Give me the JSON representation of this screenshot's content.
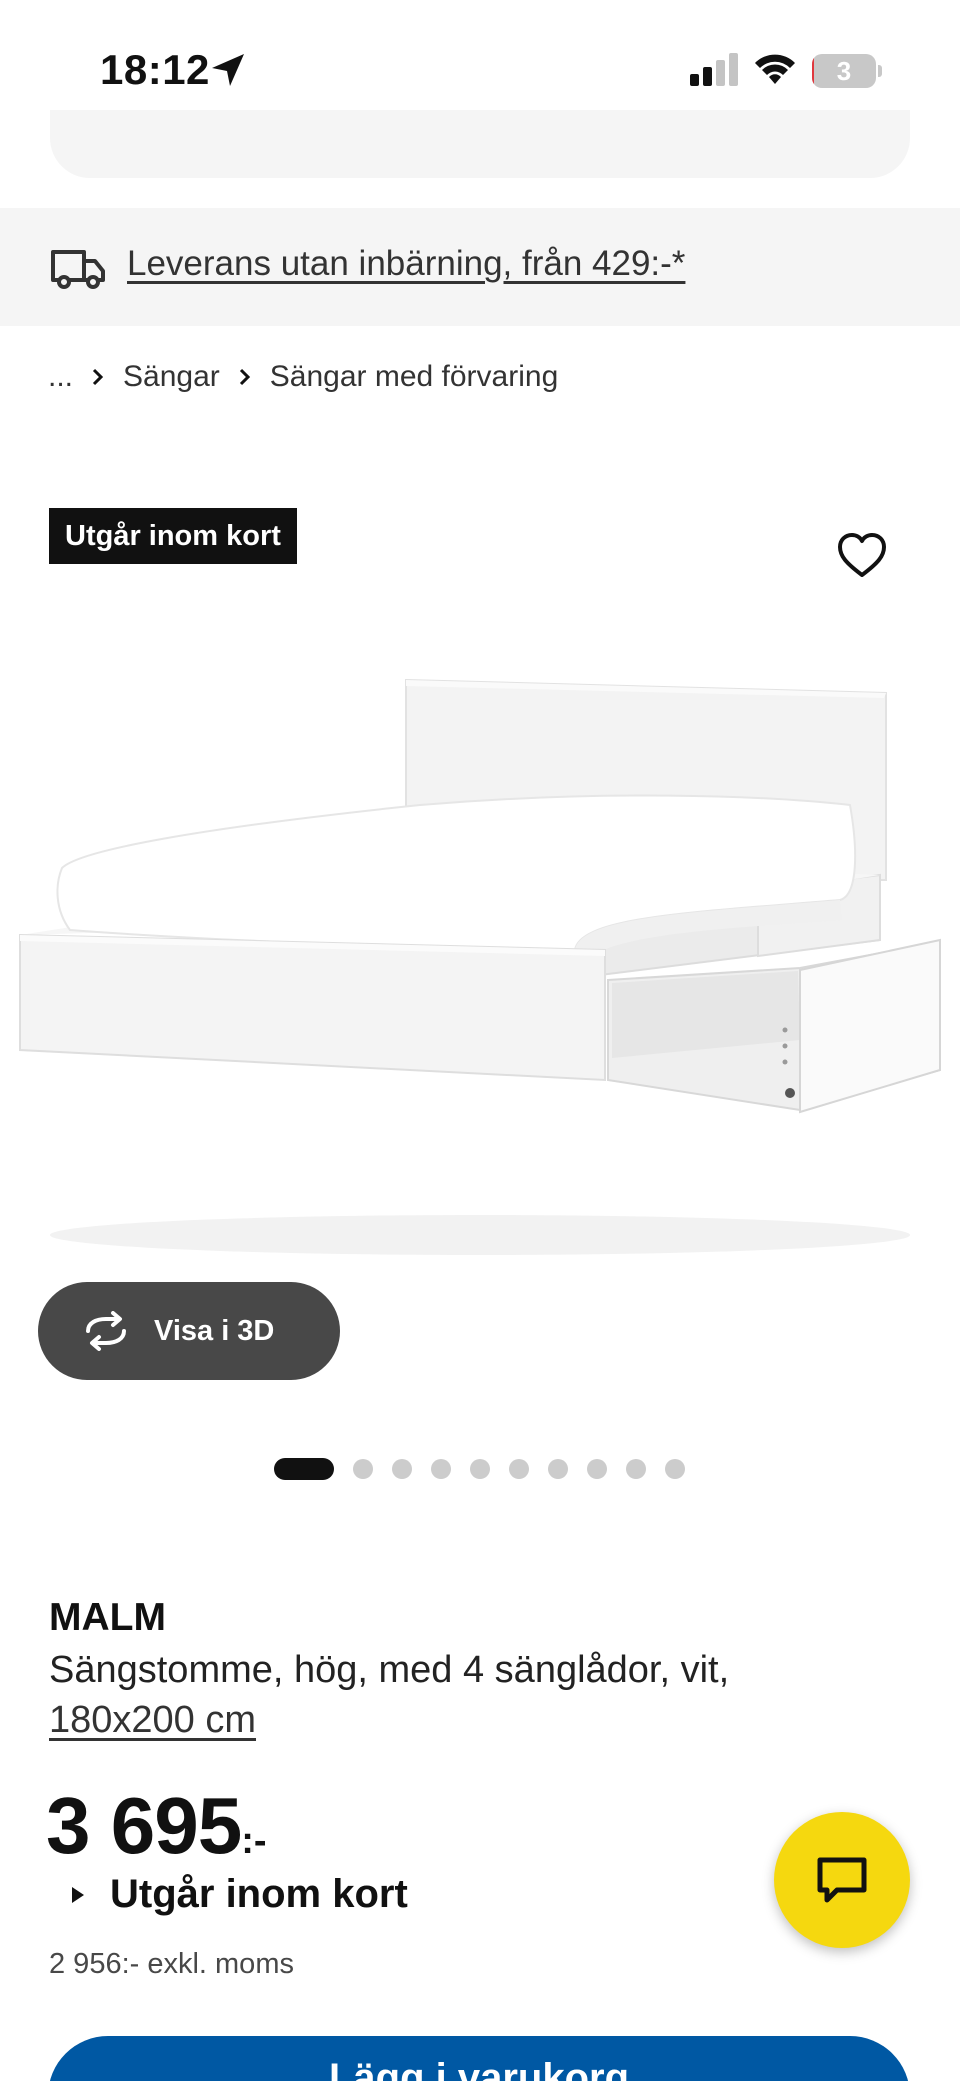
{
  "status_bar": {
    "time": "18:12",
    "battery_level": "3",
    "battery_fraction": 0.03,
    "icons": [
      "location-arrow-icon",
      "cellular-signal-icon",
      "wifi-icon",
      "battery-icon"
    ]
  },
  "delivery_banner": {
    "icon": "truck-icon",
    "text": "Leverans utan inbärning, från 429:-*"
  },
  "breadcrumb": {
    "items": [
      "...",
      "Sängar",
      "Sängar med förvaring"
    ],
    "separator_icon": "chevron-right-icon"
  },
  "gallery": {
    "status_tag": "Utgår inom kort",
    "favorite_icon": "heart-outline-icon",
    "image_alt": "MALM bed frame with storage drawer open",
    "view_3d_label": "Visa i 3D",
    "view_3d_icon": "rotate-3d-icon",
    "carousel": {
      "total": 11,
      "active": 1
    }
  },
  "product": {
    "brand": "MALM",
    "description": "Sängstomme, hög, med 4 sänglådor, vit,",
    "size": "180x200 cm",
    "price": "3 695",
    "price_suffix": ":-",
    "availability": "Utgår inom kort",
    "price_excl_vat": "2 956:- exkl. moms"
  },
  "chat": {
    "icon": "chat-bubble-icon"
  },
  "cart": {
    "label": "Lägg i varukorg"
  },
  "colors": {
    "accent_blue": "#0058a3",
    "chat_yellow": "#f5d80f",
    "tag_black": "#111111",
    "button_dark": "#484848",
    "battery_red": "#e0383e"
  }
}
